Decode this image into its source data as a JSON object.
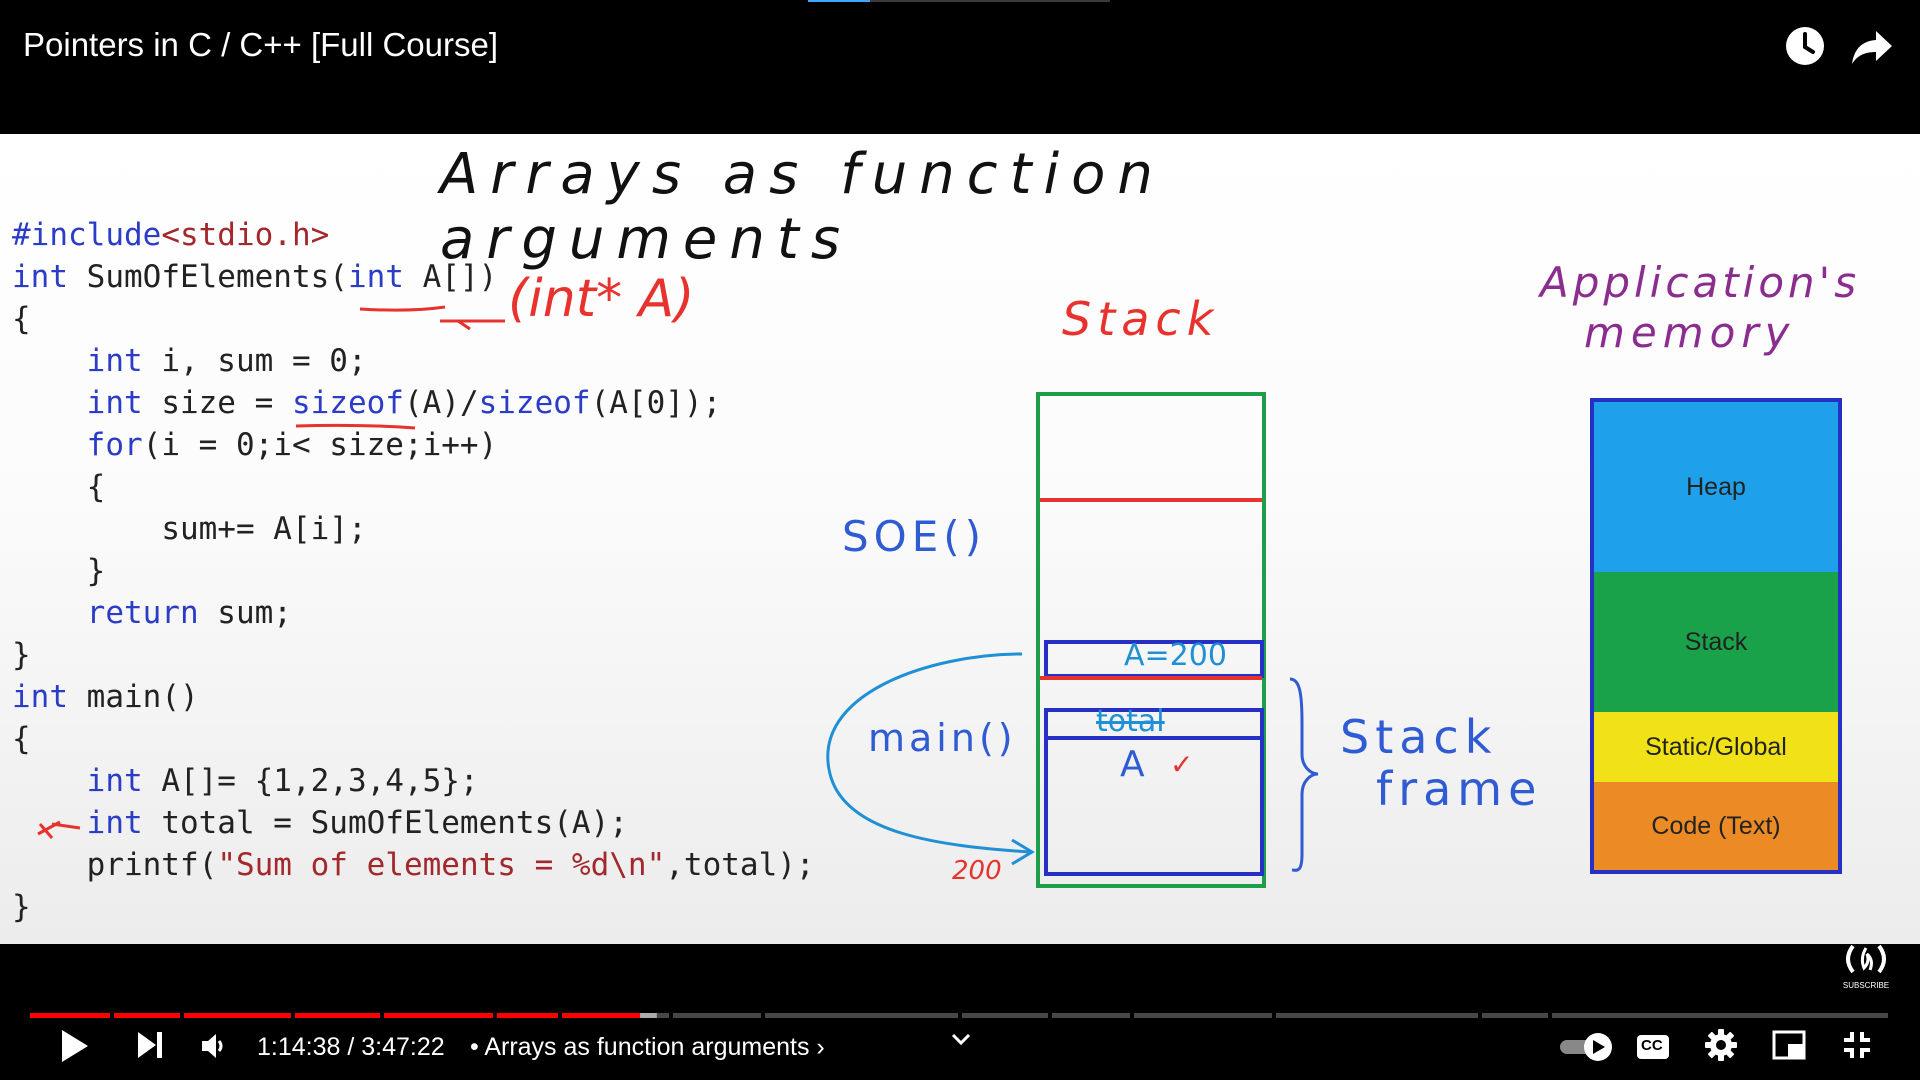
{
  "player": {
    "title": "Pointers in C / C++ [Full Course]",
    "watch_later_icon": "clock-icon",
    "share_icon": "share-arrow-icon"
  },
  "slide": {
    "heading": "Arrays as function arguments",
    "code": {
      "line1_a": "#include",
      "line1_b": "<stdio.h>",
      "line2_kw1": "int",
      "line2_a": " SumOfElements(",
      "line2_kw2": "int",
      "line2_b": " A[])",
      "line3": "{",
      "line4_kw": "int",
      "line4_b": " i, sum = 0;",
      "line5_kw": "int",
      "line5_a": " size = ",
      "line5_fn1": "sizeof",
      "line5_b": "(A)/",
      "line5_fn2": "sizeof",
      "line5_c": "(A[0]);",
      "line6_kw": "for",
      "line6_b": "(i = 0;i< size;i++)",
      "line7": "{",
      "line8": "sum+= A[i];",
      "line9": "}",
      "line10_kw": "return",
      "line10_b": " sum;",
      "line11": "}",
      "line12_kw": "int",
      "line12_b": " main()",
      "line13": "{",
      "line14_kw": "int",
      "line14_b": " A[]= {1,2,3,4,5};",
      "line15_kw": "int",
      "line15_b": " total = SumOfElements(A);",
      "line16_a": "printf(",
      "line16_str": "\"Sum of elements = %d\\n\"",
      "line16_b": ",total);",
      "line17": "}"
    },
    "annotations": {
      "int_ptr_note": "(int* A)",
      "stack_label": "Stack",
      "soe_label": "SOE()",
      "main_label": "main()",
      "frame_a200": "A=200",
      "frame_total": "total",
      "frame_a": "A",
      "addr_200": "200",
      "stack_frame_line1": "Stack",
      "stack_frame_line2": "frame",
      "app_memory_line1": "Application's",
      "app_memory_line2": "memory"
    },
    "memory_segments": [
      {
        "label": "Heap",
        "color": "#1fa0ea"
      },
      {
        "label": "Stack",
        "color": "#19a24a"
      },
      {
        "label": "Static/Global",
        "color": "#f1e217"
      },
      {
        "label": "Code (Text)",
        "color": "#ec8b25"
      }
    ],
    "colors": {
      "handwriting_red": "#e8322d",
      "handwriting_blue": "#2f5bd3",
      "handwriting_purple": "#8b2c8f",
      "stack_outline": "#1e9e46",
      "memory_outline": "#2630c4"
    }
  },
  "controls": {
    "play_icon": "play-icon",
    "next_icon": "skip-next-icon",
    "volume_icon": "volume-icon",
    "time": "1:14:38 / 3:47:22",
    "chapter": "• Arrays as function arguments ›",
    "chapter_expand_icon": "chevron-down-icon",
    "autoplay_icon": "autoplay-toggle-icon",
    "cc_label": "CC",
    "settings_icon": "gear-icon",
    "miniplayer_icon": "miniplayer-icon",
    "fullscreen_icon": "exit-fullscreen-icon",
    "channel_badge_label": "SUBSCRIBE",
    "progress_fraction": 0.328,
    "buffered_fraction": 0.337,
    "colors": {
      "played": "#ff0000",
      "buffered": "rgba(255,255,255,0.55)",
      "track": "rgba(255,255,255,0.28)"
    }
  }
}
